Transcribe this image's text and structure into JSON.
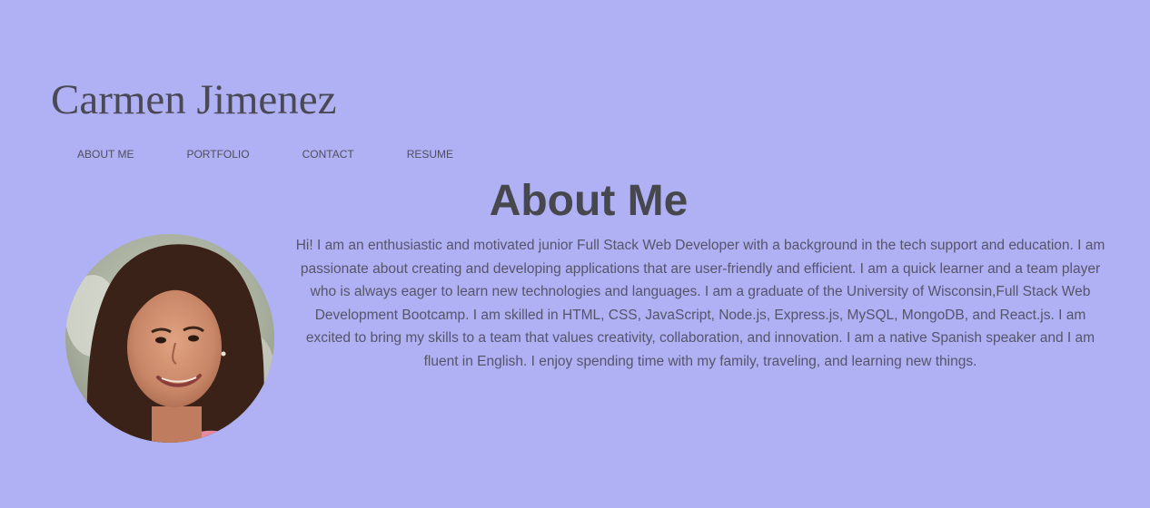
{
  "header": {
    "site_name": "Carmen Jimenez"
  },
  "nav": {
    "items": [
      {
        "label": "ABOUT ME"
      },
      {
        "label": "PORTFOLIO"
      },
      {
        "label": "CONTACT"
      },
      {
        "label": "RESUME"
      }
    ]
  },
  "about": {
    "title": "About Me",
    "bio": "Hi! I am an enthusiastic and motivated junior Full Stack Web Developer with a background in the tech support and education. I am passionate about creating and developing applications that are user-friendly and efficient. I am a quick learner and a team player who is always eager to learn new technologies and languages. I am a graduate of the University of Wisconsin,Full Stack Web Development Bootcamp. I am skilled in HTML, CSS, JavaScript, Node.js, Express.js, MySQL, MongoDB, and React.js. I am excited to bring my skills to a team that values creativity, collaboration, and innovation. I am a native Spanish speaker and I am fluent in English. I enjoy spending time with my family, traveling, and learning new things."
  },
  "theme": {
    "background": "#b0b0f4",
    "text": "#4a4a52"
  }
}
